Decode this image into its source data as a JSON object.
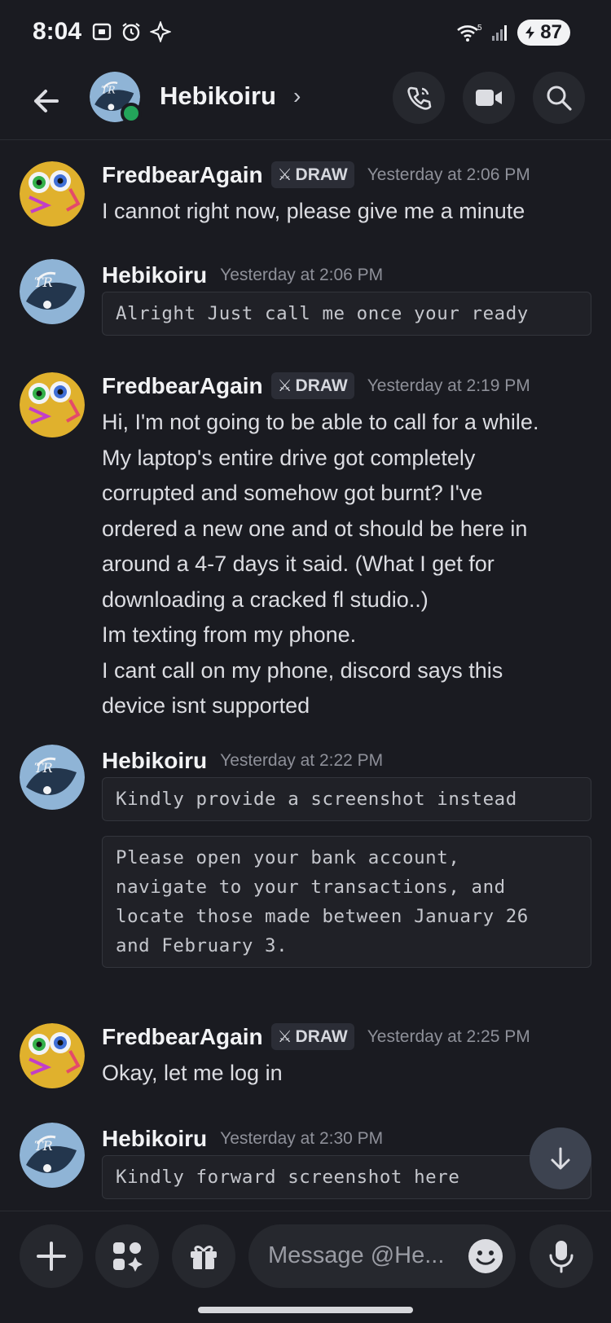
{
  "status_bar": {
    "time": "8:04",
    "battery": "87",
    "signal_label": "5"
  },
  "header": {
    "contact_name": "Hebikoiru",
    "chevron": "›",
    "status_color": "#23a55a"
  },
  "messages": [
    {
      "author": "FredbearAgain",
      "tag": "DRAW",
      "time": "Yesterday at 2:06 PM",
      "lines": [
        "I cannot right now, please give me a minute"
      ]
    },
    {
      "author": "Hebikoiru",
      "time": "Yesterday at 2:06 PM",
      "code": "Alright Just call me once your ready"
    },
    {
      "author": "FredbearAgain",
      "tag": "DRAW",
      "time": "Yesterday at 2:19 PM",
      "lines": [
        "Hi, I'm not going to be able to call for a while.",
        "My laptop's entire drive got completely",
        "corrupted and somehow got burnt? I've",
        "ordered a new one and ot should be here in",
        "around a 4-7 days it said. (What I get for",
        "downloading a cracked fl studio..)",
        "Im texting from my phone.",
        "I cant call on my phone, discord says this",
        "device isnt supported"
      ]
    },
    {
      "author": "Hebikoiru",
      "time": "Yesterday at 2:22 PM",
      "code": "Kindly provide a screenshot instead",
      "code2": "Please open your bank account,\nnavigate to your transactions, and\nlocate those made between January 26\nand February 3."
    },
    {
      "author": "FredbearAgain",
      "tag": "DRAW",
      "time": "Yesterday at 2:25 PM",
      "lines": [
        "Okay, let me log in"
      ]
    },
    {
      "author": "Hebikoiru",
      "time": "Yesterday at 2:30 PM",
      "code": "Kindly forward screenshot here"
    }
  ],
  "composer": {
    "placeholder": "Message @He..."
  },
  "colors": {
    "background": "#1a1b21",
    "accent_online": "#23a55a",
    "code_background": "#202127"
  }
}
